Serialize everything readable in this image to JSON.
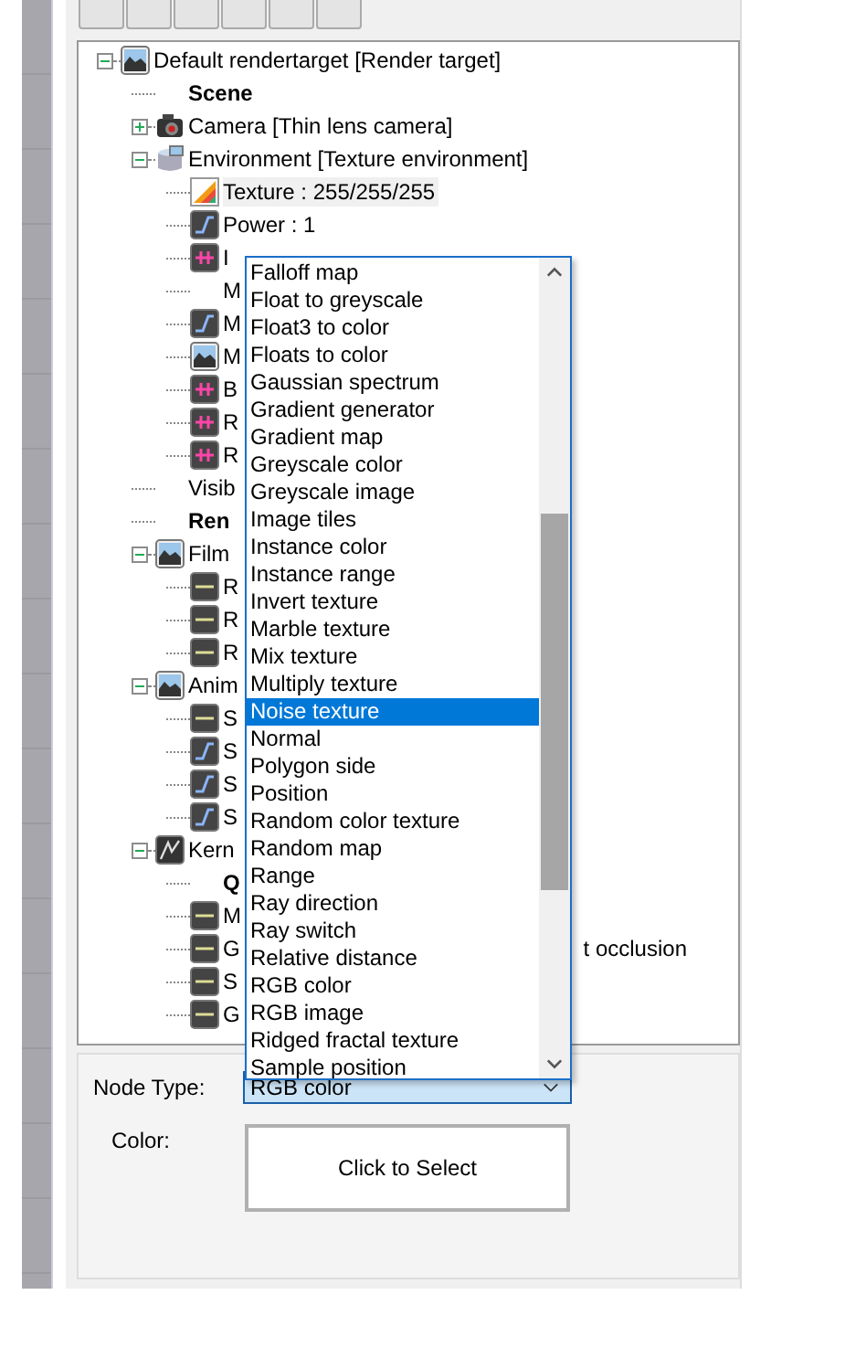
{
  "tree": [
    {
      "label": "Default rendertarget  [Render target]",
      "kind": "image",
      "expanded": true,
      "selected": false,
      "children": [
        {
          "label": "Scene",
          "kind": "heading",
          "selected": false
        },
        {
          "label": "Camera  [Thin lens camera]",
          "kind": "camera",
          "expanded": false,
          "selected": false
        },
        {
          "label": "Environment  [Texture environment]",
          "kind": "environment",
          "expanded": true,
          "selected": false,
          "children": [
            {
              "label": "Texture : 255/255/255",
              "kind": "texture",
              "selected": true
            },
            {
              "label": "Power : 1",
              "kind": "curve",
              "selected": false
            },
            {
              "label": "I",
              "kind": "pin",
              "selected": false
            },
            {
              "label": "M",
              "kind": "plain",
              "selected": false
            },
            {
              "label": "M",
              "kind": "curve",
              "selected": false
            },
            {
              "label": "M",
              "kind": "image",
              "selected": false
            },
            {
              "label": "B",
              "kind": "pin",
              "selected": false
            },
            {
              "label": "R",
              "kind": "pin",
              "selected": false
            },
            {
              "label": "R",
              "kind": "pin",
              "selected": false
            }
          ]
        },
        {
          "label": "Visib",
          "kind": "plain",
          "selected": false
        },
        {
          "label": "Ren",
          "kind": "heading",
          "selected": false
        },
        {
          "label": "Film",
          "kind": "image",
          "expanded": true,
          "selected": false,
          "children": [
            {
              "label": "R",
              "kind": "bar",
              "selected": false
            },
            {
              "label": "R",
              "kind": "bar",
              "selected": false
            },
            {
              "label": "R",
              "kind": "bar",
              "selected": false
            }
          ]
        },
        {
          "label": "Anim",
          "kind": "image",
          "expanded": true,
          "selected": false,
          "children": [
            {
              "label": "S",
              "kind": "bar",
              "selected": false
            },
            {
              "label": "S",
              "kind": "curve",
              "selected": false
            },
            {
              "label": "S",
              "kind": "curve",
              "selected": false
            },
            {
              "label": "S",
              "kind": "curve",
              "selected": false
            }
          ]
        },
        {
          "label": "Kern",
          "kind": "kernel",
          "expanded": true,
          "selected": false,
          "children": [
            {
              "label": "Q",
              "kind": "heading",
              "selected": false
            },
            {
              "label": "M",
              "kind": "bar",
              "selected": false
            },
            {
              "label": "G",
              "kind": "bar",
              "selected": false,
              "tail": "t occlusion"
            },
            {
              "label": "S",
              "kind": "bar",
              "selected": false
            },
            {
              "label": "G",
              "kind": "bar",
              "selected": false
            }
          ]
        }
      ]
    }
  ],
  "dropdown_list": [
    {
      "label": "Falloff map",
      "selected": false
    },
    {
      "label": "Float to greyscale",
      "selected": false
    },
    {
      "label": "Float3 to color",
      "selected": false
    },
    {
      "label": "Floats to color",
      "selected": false
    },
    {
      "label": "Gaussian spectrum",
      "selected": false
    },
    {
      "label": "Gradient generator",
      "selected": false
    },
    {
      "label": "Gradient map",
      "selected": false
    },
    {
      "label": "Greyscale color",
      "selected": false
    },
    {
      "label": "Greyscale image",
      "selected": false
    },
    {
      "label": "Image tiles",
      "selected": false
    },
    {
      "label": "Instance color",
      "selected": false
    },
    {
      "label": "Instance range",
      "selected": false
    },
    {
      "label": "Invert texture",
      "selected": false
    },
    {
      "label": "Marble texture",
      "selected": false
    },
    {
      "label": "Mix texture",
      "selected": false
    },
    {
      "label": "Multiply texture",
      "selected": false
    },
    {
      "label": "Noise texture",
      "selected": true
    },
    {
      "label": "Normal",
      "selected": false
    },
    {
      "label": "Polygon side",
      "selected": false
    },
    {
      "label": "Position",
      "selected": false
    },
    {
      "label": "Random color texture",
      "selected": false
    },
    {
      "label": "Random map",
      "selected": false
    },
    {
      "label": "Range",
      "selected": false
    },
    {
      "label": "Ray direction",
      "selected": false
    },
    {
      "label": "Ray switch",
      "selected": false
    },
    {
      "label": "Relative distance",
      "selected": false
    },
    {
      "label": "RGB color",
      "selected": false
    },
    {
      "label": "RGB image",
      "selected": false
    },
    {
      "label": "Ridged fractal texture",
      "selected": false
    },
    {
      "label": "Sample position",
      "selected": false
    }
  ],
  "node_panel": {
    "node_type_label": "Node Type:",
    "node_type_value": "RGB color",
    "color_label": "Color:",
    "color_button": "Click to Select"
  }
}
